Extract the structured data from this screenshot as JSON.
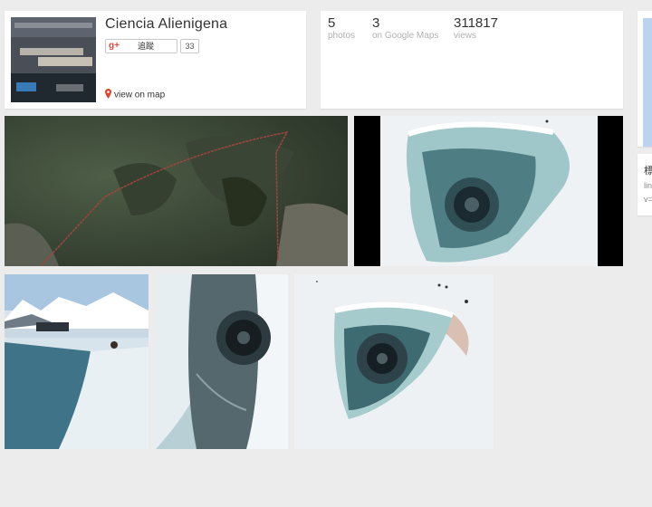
{
  "profile": {
    "name": "Ciencia Alienigena",
    "follow_label": "追蹤",
    "gplus_icon": "g+",
    "follower_count": "33",
    "view_on_map": "view on map"
  },
  "stats": [
    {
      "value": "5",
      "label": "photos"
    },
    {
      "value": "3",
      "label": "on Google Maps"
    },
    {
      "value": "311817",
      "label": "views"
    }
  ],
  "side": {
    "info_title": "標",
    "info_line1": "lin",
    "info_line2": "v="
  },
  "icons": {
    "map_pin": "map-pin-icon",
    "gplus": "google-plus-icon"
  },
  "colors": {
    "background": "#ececec",
    "card": "#ffffff",
    "gplus_red": "#dd4b39",
    "pin_red": "#e0452f"
  }
}
